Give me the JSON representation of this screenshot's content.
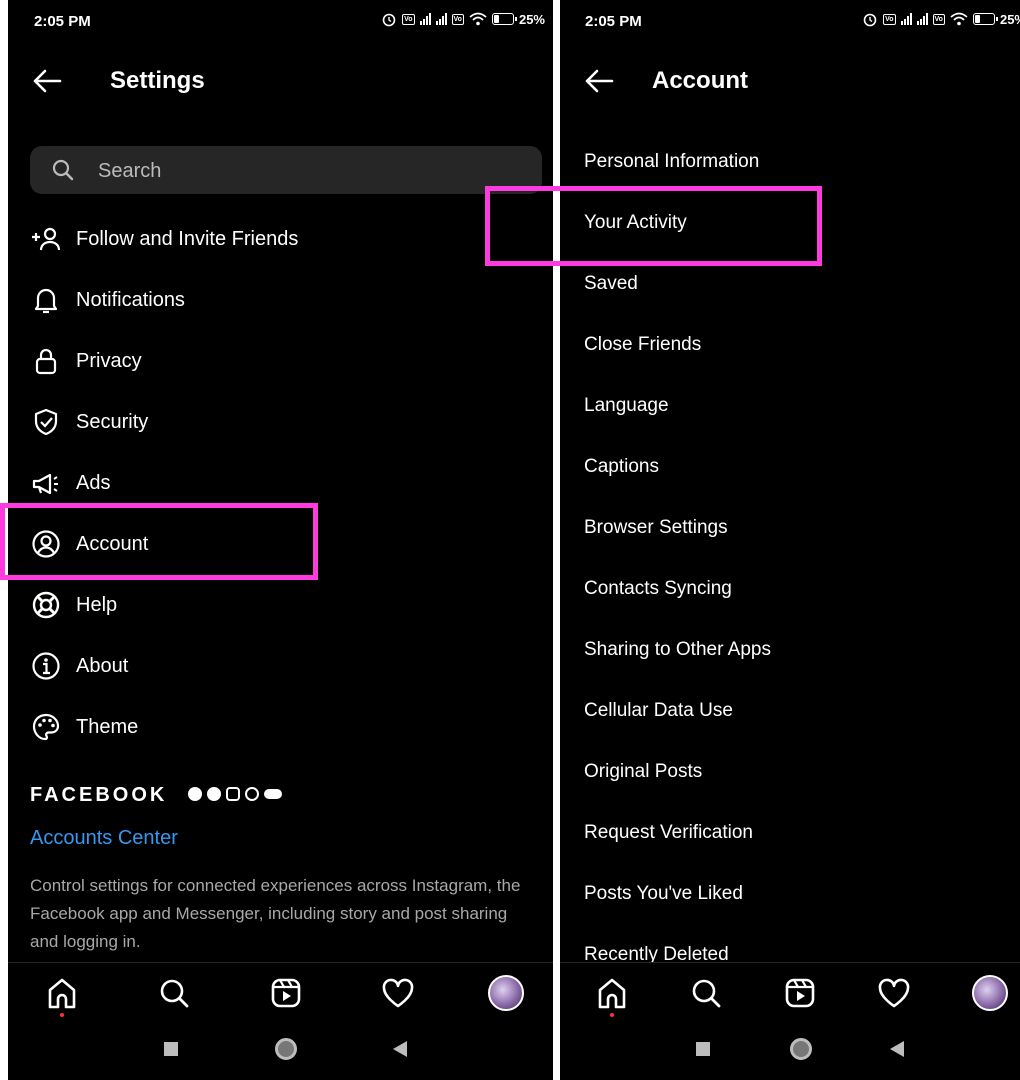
{
  "left": {
    "status": {
      "time": "2:05 PM",
      "battery": "25%"
    },
    "header": {
      "title": "Settings"
    },
    "search": {
      "placeholder": "Search"
    },
    "menu": [
      {
        "label": "Follow and Invite Friends",
        "icon": "add-person-icon"
      },
      {
        "label": "Notifications",
        "icon": "bell-icon"
      },
      {
        "label": "Privacy",
        "icon": "lock-icon"
      },
      {
        "label": "Security",
        "icon": "shield-icon"
      },
      {
        "label": "Ads",
        "icon": "megaphone-icon"
      },
      {
        "label": "Account",
        "icon": "user-circle-icon"
      },
      {
        "label": "Help",
        "icon": "lifebuoy-icon"
      },
      {
        "label": "About",
        "icon": "info-icon"
      },
      {
        "label": "Theme",
        "icon": "palette-icon"
      }
    ],
    "facebook": {
      "title": "FACEBOOK",
      "accounts_center": "Accounts Center",
      "description": "Control settings for connected experiences across Instagram, the Facebook app and Messenger, including story and post sharing and logging in."
    }
  },
  "right": {
    "status": {
      "time": "2:05 PM",
      "battery": "25%"
    },
    "header": {
      "title": "Account"
    },
    "items": [
      "Personal Information",
      "Your Activity",
      "Saved",
      "Close Friends",
      "Language",
      "Captions",
      "Browser Settings",
      "Contacts Syncing",
      "Sharing to Other Apps",
      "Cellular Data Use",
      "Original Posts",
      "Request Verification",
      "Posts You've Liked",
      "Recently Deleted"
    ]
  },
  "colors": {
    "background": "#000000",
    "link": "#3897f0",
    "highlight": "#ff3be0",
    "search_bg": "#262626"
  }
}
